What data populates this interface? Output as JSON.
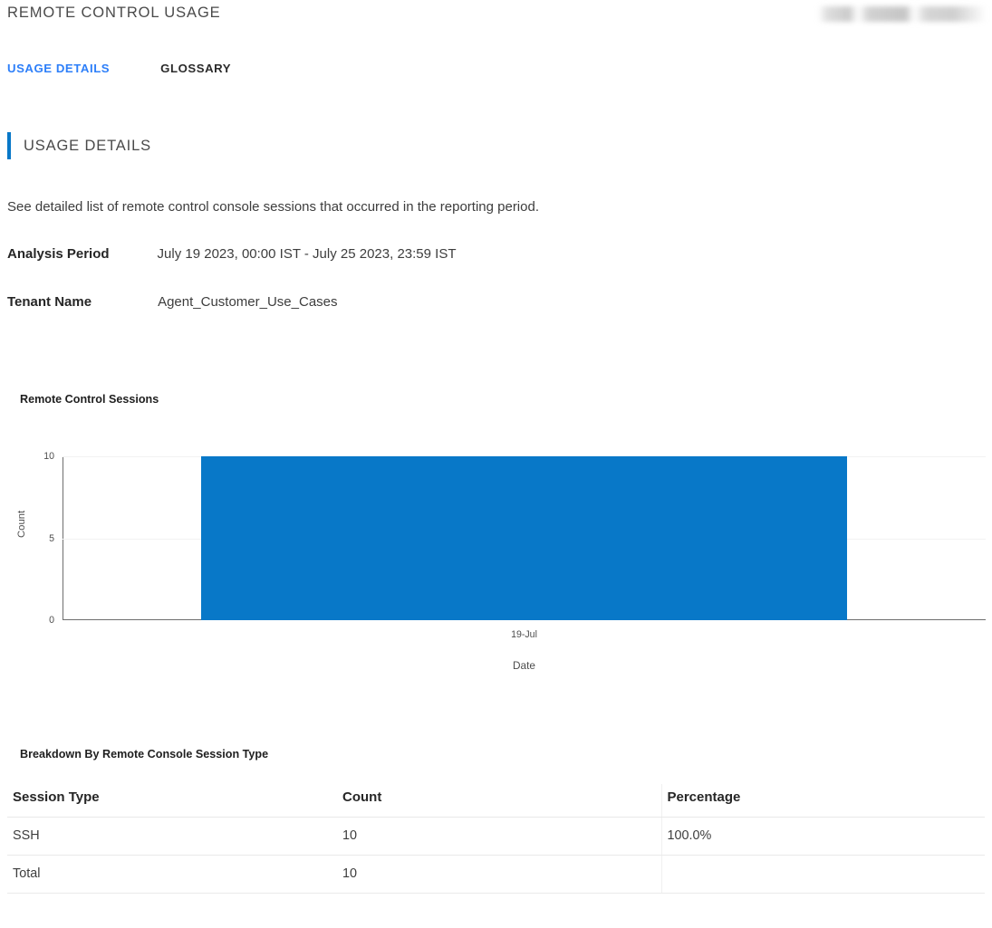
{
  "header": {
    "title": "REMOTE CONTROL USAGE",
    "redacted_stamp": ""
  },
  "tabs": [
    {
      "label": "USAGE DETAILS",
      "active": true
    },
    {
      "label": "GLOSSARY",
      "active": false
    }
  ],
  "section": {
    "heading": "USAGE DETAILS",
    "accent_color": "#0878c8",
    "description": "See detailed list of remote control console sessions that occurred in the reporting period.",
    "meta": [
      {
        "label": "Analysis Period",
        "value": "July 19 2023, 00:00 IST - July 25 2023, 23:59 IST"
      },
      {
        "label": "Tenant Name",
        "value": "Agent_Customer_Use_Cases"
      }
    ]
  },
  "chart_data": {
    "type": "bar",
    "title": "Remote Control Sessions",
    "categories": [
      "19-Jul"
    ],
    "values": [
      10
    ],
    "series": [
      {
        "name": "Count",
        "values": [
          10
        ]
      }
    ],
    "xlabel": "Date",
    "ylabel": "Count",
    "yticks": [
      0,
      5,
      10
    ],
    "ylim": [
      0,
      10
    ],
    "grid": true,
    "legend": false,
    "bar_color": "#0878c8"
  },
  "breakdown": {
    "title": "Breakdown By Remote Console Session Type",
    "columns": [
      "Session Type",
      "Count",
      "Percentage"
    ],
    "rows": [
      {
        "type": "SSH",
        "count": "10",
        "percentage": "100.0%"
      },
      {
        "type": "Total",
        "count": "10",
        "percentage": ""
      }
    ]
  }
}
